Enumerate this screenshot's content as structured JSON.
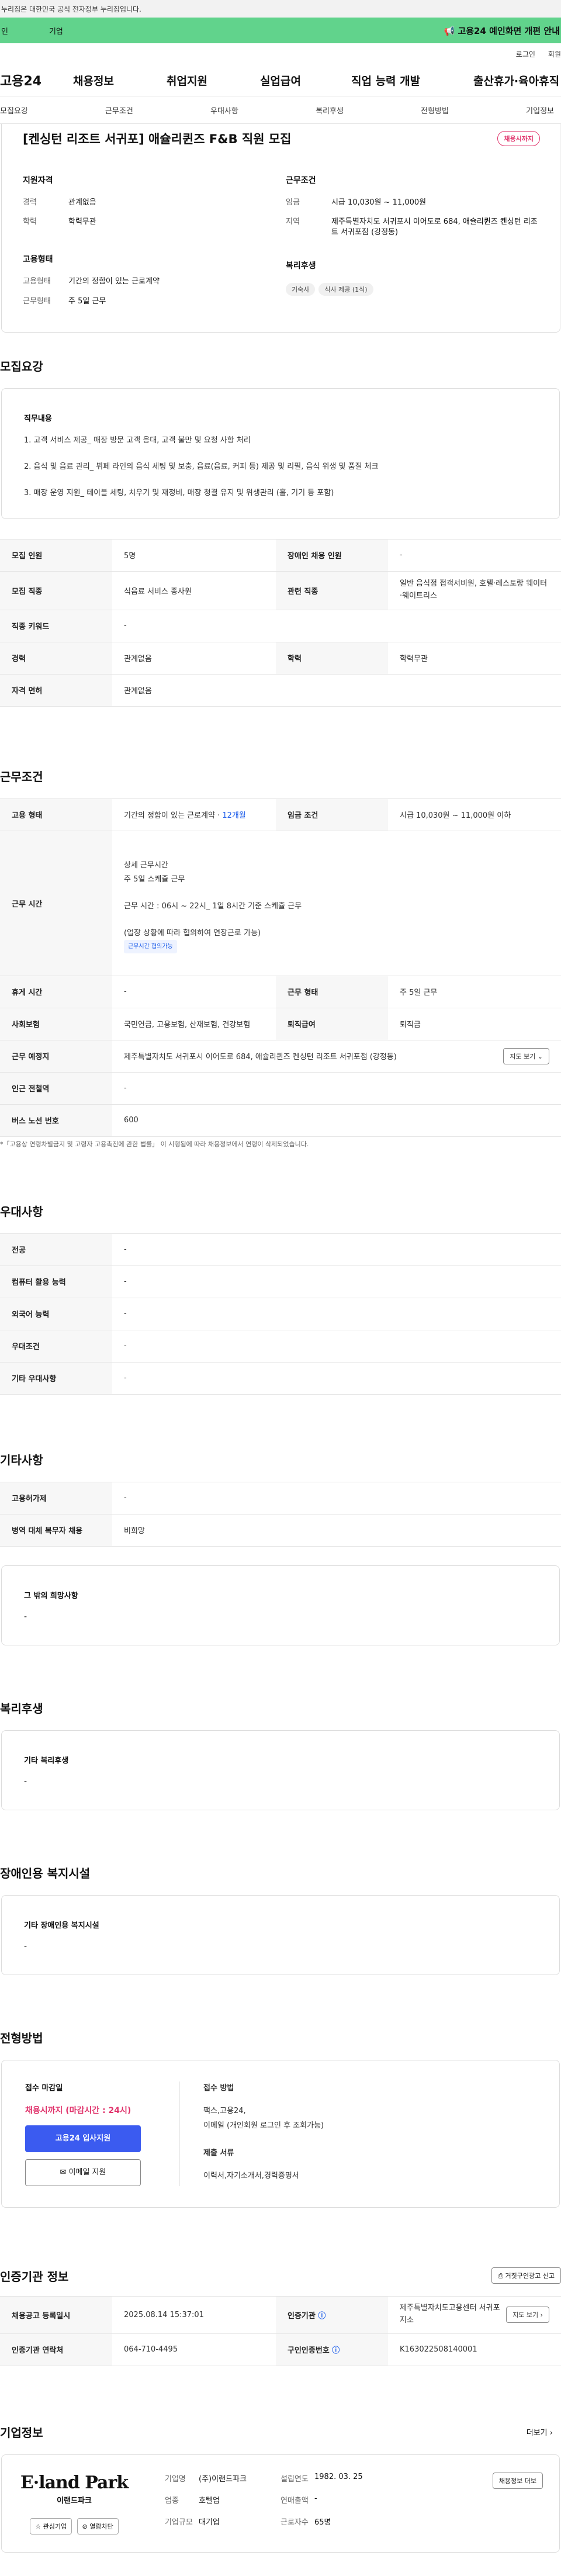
{
  "header": {
    "gov_notice": "누리집은 대한민국 공식 전자정부 누리집입니다.",
    "green_left": [
      "인",
      "기업"
    ],
    "green_notice": "고용24 예인화면 개편 안내",
    "util": [
      "로그인",
      "회원"
    ],
    "logo": "고용24",
    "menu": [
      "채용정보",
      "취업지원",
      "실업급여",
      "직업 능력 개발",
      "출산휴가·육아휴직"
    ],
    "tabs": [
      "모집요강",
      "근무조건",
      "우대사항",
      "복리후생",
      "전형방법",
      "기업정보"
    ]
  },
  "job": {
    "title": "[켄싱턴 리조트 서귀포] 애슐리퀸즈 F&B 직원 모집",
    "status_badge": "채용시까지",
    "qual_heading": "지원자격",
    "career_k": "경력",
    "career_v": "관계없음",
    "edu_k": "학력",
    "edu_v": "학력무관",
    "emp_heading": "고용형태",
    "emptype_k": "고용형태",
    "emptype_v": "기간의 정함이 있는 근로계약",
    "work_k": "근무형태",
    "work_v": "주 5일 근무",
    "cond_heading": "근무조건",
    "wage_k": "임금",
    "wage_v": "시급 10,030원 ~ 11,000원",
    "area_k": "지역",
    "area_v": "제주특별자치도 서귀포시 이어도로 684, 애슐리퀸즈 켄싱턴 리조트 서귀포점 (강정동)",
    "welfare_heading": "복리후생",
    "welfare_chips": [
      "기숙사",
      "식사 제공 (1식)"
    ]
  },
  "recruit": {
    "heading": "모집요강",
    "duty_title": "직무내용",
    "duties": [
      "1. 고객 서비스 제공_ 매장 방문 고객 응대, 고객 불만 및 요청 사항 처리",
      "2. 음식 및 음료 관리_ 뷔페 라인의 음식 세팅 및 보충, 음료(음료, 커피 등) 제공 및 리필, 음식 위생 및 품질 체크",
      "3. 매장 운영 지원_ 테이블 세팅, 치우기 및 재정비, 매장 청결 유지 및 위생관리 (홀, 기기 등 포함)"
    ],
    "rows": [
      [
        "모집 인원",
        "5명",
        "장애인 채용 인원",
        "-"
      ],
      [
        "모집 직종",
        "식음료 서비스 종사원",
        "관련 직종",
        "일반 음식점 접객서비원, 호텔·레스토랑 웨이터·웨이트리스"
      ],
      [
        "직종 키워드",
        "-",
        "",
        ""
      ],
      [
        "경력",
        "관계없음",
        "학력",
        "학력무관"
      ],
      [
        "자격 면허",
        "관계없음",
        "",
        ""
      ]
    ]
  },
  "conditions": {
    "heading": "근무조건",
    "emp_k": "고용 형태",
    "emp_v": "기간의 정함이 있는 근로계약 · ",
    "emp_period": "12개월",
    "wage_k": "임금 조건",
    "wage_v": "시급 10,030원 ~ 11,000원 이하",
    "time_k": "근무 시간",
    "time_lines": [
      "상세 근무시간",
      "주 5일 스케쥴 근무",
      "근무 시간 : 06시 ~ 22시_ 1일 8시간 기준 스케쥴 근무",
      "(업장 상황에 따라 협의하여 연장근로 가능)"
    ],
    "time_chip": "근무시간 협의가능",
    "rest_k": "휴게 시간",
    "rest_v": "-",
    "shape_k": "근무 형태",
    "shape_v": "주 5일 근무",
    "ins_k": "사회보험",
    "ins_v": "국민연금, 고용보험, 산재보험, 건강보험",
    "retire_k": "퇴직급여",
    "retire_v": "퇴직금",
    "place_k": "근무 예정지",
    "place_v": "제주특별자치도 서귀포시 이어도로 684, 애슐리퀸즈 켄싱턴 리조트 서귀포점 (강정동)",
    "map_btn": "지도 보기",
    "subway_k": "인근 전철역",
    "subway_v": "-",
    "bus_k": "버스 노선 번호",
    "bus_v": "600",
    "footnote": "*「고용상 연령차별금지 및 고령자 고용촉진에 관한 법률」 이 시행됨에 따라 채용정보에서 연령이 삭제되었습니다."
  },
  "preference": {
    "heading": "우대사항",
    "rows": [
      [
        "전공",
        "-"
      ],
      [
        "컴퓨터 활용 능력",
        "-"
      ],
      [
        "외국어 능력",
        "-"
      ],
      [
        "우대조건",
        "-"
      ],
      [
        "기타 우대사항",
        "-"
      ]
    ]
  },
  "etc": {
    "heading": "기타사항",
    "rows": [
      [
        "고용허가제",
        "-"
      ],
      [
        "병역 대체 복무자 채용",
        "비희망"
      ]
    ],
    "box_title": "그 밖의 희망사항",
    "box_value": "-"
  },
  "welfare": {
    "heading": "복리후생",
    "box_title": "기타 복리후생",
    "box_value": "-"
  },
  "disabled": {
    "heading": "장애인용 복지시설",
    "box_title": "기타 장애인용 복지시설",
    "box_value": "-"
  },
  "process": {
    "heading": "전형방법",
    "deadline_title": "접수 마감일",
    "deadline": "채용시까지 (마감시간 : 24시)",
    "apply_btn": "고용24 입사지원",
    "email_btn": "이메일 지원",
    "method_title": "접수 방법",
    "methods": [
      "팩스,고용24,",
      "이메일 (개인회원 로그인 후 조회가능)"
    ],
    "docs_title": "제출 서류",
    "docs": "이력서,자기소개서,경력증명서"
  },
  "certification": {
    "heading": "인증기관 정보",
    "report_btn": "거짓구인광고 신고",
    "rows": [
      [
        "채용공고 등록일시",
        "2025.08.14 15:37:01",
        "인증기관",
        "제주특별자치도고용센터 서귀포지소"
      ],
      [
        "인증기관 연락처",
        "064-710-4495",
        "구인인증번호",
        "K163022508140001"
      ]
    ],
    "map_btn": "지도 보기"
  },
  "company": {
    "heading": "기업정보",
    "more": "더보기",
    "logo_text": "E·land Park",
    "logo_sub": "이랜드파크",
    "interest_btn": "관심기업",
    "block_btn": "열람차단",
    "info": [
      [
        "기업명",
        "(주)이랜드파크",
        "설립연도",
        "1982. 03. 25"
      ],
      [
        "업종",
        "호텔업",
        "연매출액",
        "-"
      ],
      [
        "기업규모",
        "대기업",
        "근로자수",
        "65명"
      ]
    ],
    "jobs_btn": "채용정보 더보"
  }
}
